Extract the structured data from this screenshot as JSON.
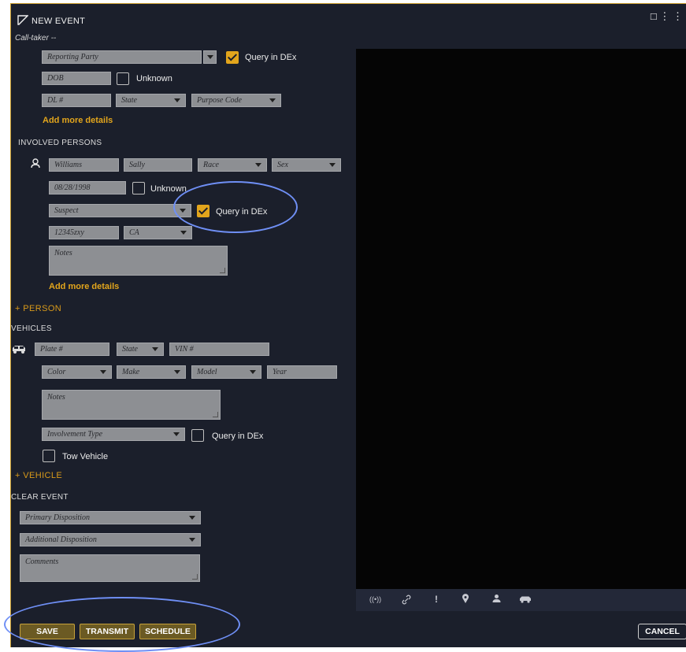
{
  "header": {
    "title": "NEW EVENT",
    "call_taker": "Call-taker --"
  },
  "reporting": {
    "party_placeholder": "Reporting Party",
    "query_label": "Query in DEx",
    "dob_placeholder": "DOB",
    "unknown_label": "Unknown",
    "dl_placeholder": "DL #",
    "state_placeholder": "State",
    "purpose_placeholder": "Purpose Code",
    "add_more": "Add more details"
  },
  "involved": {
    "heading": "INVOLVED PERSONS",
    "last_name": "Williams",
    "first_name": "Sally",
    "race_placeholder": "Race",
    "sex_placeholder": "Sex",
    "dob": "08/28/1998",
    "unknown_label": "Unknown",
    "role": "Suspect",
    "query_label": "Query in DEx",
    "id_number": "12345zxy",
    "state": "CA",
    "notes_placeholder": "Notes",
    "add_more": "Add more details",
    "add_person": "+ PERSON"
  },
  "vehicles": {
    "heading": "VEHICLES",
    "plate_placeholder": "Plate #",
    "state_placeholder": "State",
    "vin_placeholder": "VIN #",
    "color_placeholder": "Color",
    "make_placeholder": "Make",
    "model_placeholder": "Model",
    "year_placeholder": "Year",
    "notes_placeholder": "Notes",
    "involvement_placeholder": "Involvement Type",
    "query_label": "Query in DEx",
    "tow_label": "Tow Vehicle",
    "add_vehicle": "+ VEHICLE"
  },
  "clear_event": {
    "heading": "CLEAR EVENT",
    "primary_placeholder": "Primary Disposition",
    "additional_placeholder": "Additional Disposition",
    "comments_placeholder": "Comments"
  },
  "footer": {
    "save": "SAVE",
    "transmit": "TRANSMIT",
    "schedule": "SCHEDULE",
    "cancel": "CANCEL"
  },
  "toolbar_icons": [
    "radio-icon",
    "link-icon",
    "alert-icon",
    "location-pin-icon",
    "person-icon",
    "vehicle-icon"
  ],
  "colors": {
    "accent": "#e2a51c",
    "panel": "#1b1f2b",
    "highlight": "#6f8ff5"
  }
}
